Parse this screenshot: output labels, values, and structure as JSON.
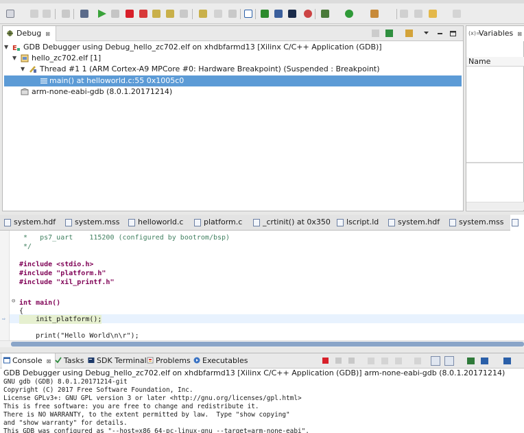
{
  "debug_view": {
    "tab_label": "Debug",
    "tree": [
      {
        "label": "GDB Debugger using Debug_hello_zc702.elf on xhdbfarmd13 [Xilinx C/C++ Application (GDB)]"
      },
      {
        "label": "hello_zc702.elf [1]"
      },
      {
        "label": "Thread #1 1 (ARM Cortex-A9 MPCore #0: Hardware Breakpoint) (Suspended : Breakpoint)"
      },
      {
        "label": "main() at helloworld.c:55 0x1005c0"
      },
      {
        "label": "arm-none-eabi-gdb (8.0.1.20171214)"
      }
    ]
  },
  "variables_view": {
    "tab_label": "Variables",
    "column_name": "Name"
  },
  "editor_tabs": [
    {
      "label": "system.hdf"
    },
    {
      "label": "system.mss"
    },
    {
      "label": "helloworld.c"
    },
    {
      "label": "platform.c"
    },
    {
      "label": "_crtinit() at 0x350"
    },
    {
      "label": "lscript.ld"
    },
    {
      "label": "system.hdf"
    },
    {
      "label": "system.mss"
    }
  ],
  "editor": {
    "lines": [
      " *   ps7_uart    115200 (configured by bootrom/bsp)",
      " */",
      "",
      "#include <stdio.h>",
      "#include \"platform.h\"",
      "#include \"xil_printf.h\"",
      "",
      "",
      "int main()",
      "{",
      "    init_platform();",
      "",
      "    print(\"Hello World\\n\\r\");"
    ]
  },
  "console_tabs": [
    {
      "label": "Console"
    },
    {
      "label": "Tasks"
    },
    {
      "label": "SDK Terminal"
    },
    {
      "label": "Problems"
    },
    {
      "label": "Executables"
    }
  ],
  "console": {
    "title": "GDB Debugger using Debug_hello_zc702.elf on xhdbfarmd13 [Xilinx C/C++ Application (GDB)] arm-none-eabi-gdb (8.0.1.20171214)",
    "lines": [
      "GNU gdb (GDB) 8.0.1.20171214-git",
      "Copyright (C) 2017 Free Software Foundation, Inc.",
      "License GPLv3+: GNU GPL version 3 or later <http://gnu.org/licenses/gpl.html>",
      "This is free software: you are free to change and redistribute it.",
      "There is NO WARRANTY, to the extent permitted by law.  Type \"show copying\"",
      "and \"show warranty\" for details.",
      "This GDB was configured as \"--host=x86_64-pc-linux-gnu --target=arm-none-eabi\"."
    ]
  }
}
